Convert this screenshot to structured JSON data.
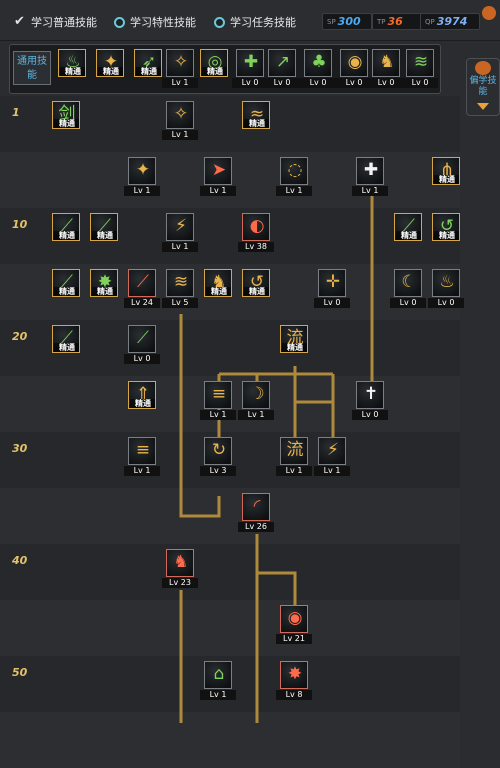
{
  "tabs": [
    {
      "label": "学习普通技能",
      "selected": true
    },
    {
      "label": "学习特性技能",
      "selected": false
    },
    {
      "label": "学习任务技能",
      "selected": false
    }
  ],
  "points": [
    {
      "tag": "SP",
      "value": "300",
      "color": "#4fa9f0"
    },
    {
      "tag": "TP",
      "value": "36",
      "color": "#ef6a2c"
    },
    {
      "tag": "QP",
      "value": "3974",
      "color": "#7fb0f5"
    }
  ],
  "quickbar": {
    "label": "通用技能",
    "slots": [
      {
        "name": "stance-skill",
        "icon": "♨",
        "color": "#7fd25a",
        "badge": "精通"
      },
      {
        "name": "rush-skill",
        "icon": "✦",
        "color": "#e9b44a",
        "badge": "精通"
      },
      {
        "name": "step-skill",
        "icon": "➶",
        "color": "#7fd25a",
        "badge": "精通"
      },
      {
        "name": "wings-skill",
        "icon": "✧",
        "color": "#e9b44a",
        "level": "Lv 1"
      },
      {
        "name": "target-skill",
        "icon": "◎",
        "color": "#7fd25a",
        "badge": "精通"
      },
      {
        "name": "cross-skill",
        "icon": "✚",
        "color": "#7fd25a",
        "level": "Lv 0"
      },
      {
        "name": "leap-skill",
        "icon": "↗",
        "color": "#7fd25a",
        "level": "Lv 0"
      },
      {
        "name": "spirit-skill",
        "icon": "♣",
        "color": "#7fd25a",
        "level": "Lv 0"
      },
      {
        "name": "eye-skill",
        "icon": "◉",
        "color": "#e9b44a",
        "level": "Lv 0"
      },
      {
        "name": "strength-skill",
        "icon": "♞",
        "color": "#e9b44a",
        "level": "Lv 0"
      },
      {
        "name": "wind-skill",
        "icon": "≋",
        "color": "#7fd25a",
        "level": "Lv 0"
      }
    ]
  },
  "side_button": {
    "label": "偏学技能"
  },
  "row_labels": [
    "1",
    "10",
    "20",
    "30",
    "40",
    "50"
  ],
  "tree": [
    {
      "name": "slash-mastery-skill",
      "icon": "剑",
      "color": "#7fd25a",
      "badge": "精通",
      "frame": "gold"
    },
    {
      "name": "feather-skill",
      "icon": "✧",
      "color": "#e9b44a",
      "level": "Lv 1",
      "frame": "plain"
    },
    {
      "name": "claw-skill",
      "icon": "≈",
      "color": "#e9b44a",
      "badge": "精通",
      "frame": "gold"
    },
    {
      "name": "fan-blade-skill",
      "icon": "✦",
      "color": "#e9b44a",
      "level": "Lv 1",
      "frame": "plain"
    },
    {
      "name": "thrust-skill",
      "icon": "➤",
      "color": "#ff6a4a",
      "level": "Lv 1",
      "frame": "plain"
    },
    {
      "name": "whirl-skill",
      "icon": "◌",
      "color": "#e9b44a",
      "level": "Lv 1",
      "frame": "plain"
    },
    {
      "name": "shield-skill",
      "icon": "✚",
      "color": "#f2f2f2",
      "level": "Lv 1",
      "frame": "plain"
    },
    {
      "name": "triple-blade-skill",
      "icon": "⋔",
      "color": "#e9b44a",
      "badge": "精通",
      "frame": "gold"
    },
    {
      "name": "green-sword-skill",
      "icon": "⟋",
      "color": "#7fd25a",
      "badge": "精通",
      "frame": "gold"
    },
    {
      "name": "green-dash-skill",
      "icon": "⟋",
      "color": "#7fd25a",
      "badge": "精通",
      "frame": "gold"
    },
    {
      "name": "flame-burst-skill",
      "icon": "⚡",
      "color": "#e9b44a",
      "level": "Lv 1",
      "frame": "plain"
    },
    {
      "name": "fire-ring-skill",
      "icon": "◐",
      "color": "#ff6a4a",
      "level": "Lv 38",
      "frame": "red"
    },
    {
      "name": "wind-cut-skill",
      "icon": "⟋",
      "color": "#7fd25a",
      "badge": "精通",
      "frame": "gold"
    },
    {
      "name": "hook-skill",
      "icon": "↺",
      "color": "#7fd25a",
      "badge": "精通",
      "frame": "gold"
    },
    {
      "name": "green-spike-skill",
      "icon": "⟋",
      "color": "#7fd25a",
      "badge": "精通",
      "frame": "gold"
    },
    {
      "name": "star-burst-skill",
      "icon": "✸",
      "color": "#7fd25a",
      "badge": "精通",
      "frame": "gold"
    },
    {
      "name": "red-slash-skill",
      "icon": "⟋",
      "color": "#ff6a4a",
      "level": "Lv 24",
      "frame": "red"
    },
    {
      "name": "wave-skill",
      "icon": "≋",
      "color": "#e9b44a",
      "level": "Lv 5",
      "frame": "plain"
    },
    {
      "name": "runner-skill",
      "icon": "♞",
      "color": "#e9b44a",
      "badge": "精通",
      "frame": "gold"
    },
    {
      "name": "swirl-skill",
      "icon": "↺",
      "color": "#e9b44a",
      "badge": "精通",
      "frame": "gold"
    },
    {
      "name": "cross-sword-skill",
      "icon": "✛",
      "color": "#e9b44a",
      "level": "Lv 0",
      "frame": "plain"
    },
    {
      "name": "crescent-skill",
      "icon": "☾",
      "color": "#e9b44a",
      "level": "Lv 0",
      "frame": "plain"
    },
    {
      "name": "flame-skill",
      "icon": "♨",
      "color": "#e9b44a",
      "level": "Lv 0",
      "frame": "plain"
    },
    {
      "name": "blade-rain-skill",
      "icon": "⟋",
      "color": "#7fd25a",
      "badge": "精通",
      "frame": "gold"
    },
    {
      "name": "green-blade-skill",
      "icon": "⟋",
      "color": "#7fd25a",
      "level": "Lv 0",
      "frame": "plain"
    },
    {
      "name": "flow-skill",
      "icon": "流",
      "color": "#e9b44a",
      "badge": "精通",
      "frame": "gold"
    },
    {
      "name": "arrow-up-skill",
      "icon": "⇑",
      "color": "#e9b44a",
      "badge": "精通",
      "frame": "gold"
    },
    {
      "name": "storm-skill",
      "icon": "≡",
      "color": "#e9b44a",
      "level": "Lv 1",
      "frame": "plain"
    },
    {
      "name": "flow-moon-skill",
      "icon": "☽",
      "color": "#e9b44a",
      "level": "Lv 1",
      "frame": "plain"
    },
    {
      "name": "sword-light-skill",
      "icon": "✝",
      "color": "#f2f2f2",
      "level": "Lv 0",
      "frame": "plain"
    },
    {
      "name": "comet-skill",
      "icon": "≡",
      "color": "#e9b44a",
      "level": "Lv 1",
      "frame": "plain"
    },
    {
      "name": "spiral-skill",
      "icon": "↻",
      "color": "#e9b44a",
      "level": "Lv 3",
      "frame": "plain"
    },
    {
      "name": "flow-burst-skill",
      "icon": "流",
      "color": "#e9b44a",
      "level": "Lv 1",
      "frame": "plain"
    },
    {
      "name": "lightning-slash-skill",
      "icon": "⚡",
      "color": "#e9b44a",
      "level": "Lv 1",
      "frame": "plain"
    },
    {
      "name": "crimson-arc-skill",
      "icon": "◜",
      "color": "#ff6a4a",
      "level": "Lv 26",
      "frame": "red"
    },
    {
      "name": "beast-skill",
      "icon": "♞",
      "color": "#ff6a4a",
      "level": "Lv 23",
      "frame": "red"
    },
    {
      "name": "crimson-moon-skill",
      "icon": "◉",
      "color": "#ff6a4a",
      "level": "Lv 21",
      "frame": "red"
    },
    {
      "name": "tower-skill",
      "icon": "⌂",
      "color": "#7fd25a",
      "level": "Lv 1",
      "frame": "plain"
    },
    {
      "name": "crimson-storm-skill",
      "icon": "✸",
      "color": "#ff6a4a",
      "level": "Lv 8",
      "frame": "red"
    }
  ]
}
